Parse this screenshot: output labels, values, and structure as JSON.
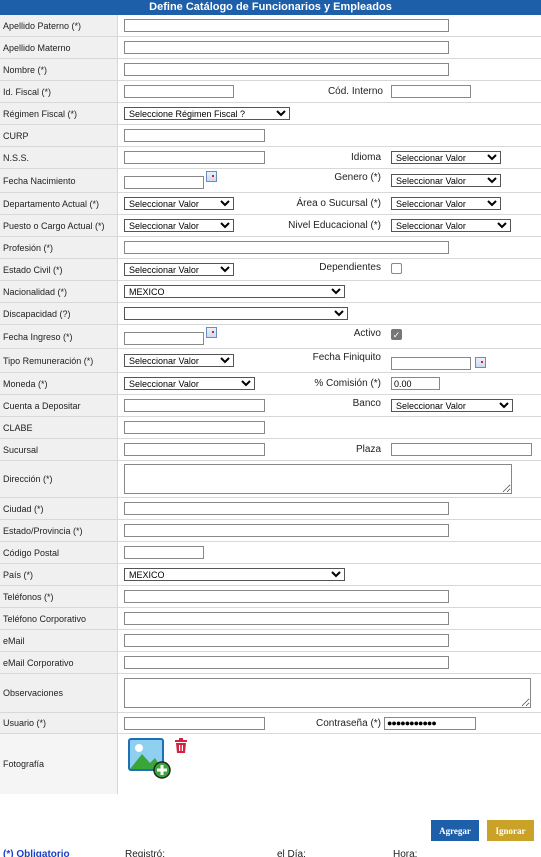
{
  "title": "Define Catálogo de Funcionarios y Empleados",
  "labels": {
    "apellido_paterno": "Apellido Paterno (*)",
    "apellido_materno": "Apellido Materno",
    "nombre": "Nombre (*)",
    "id_fiscal": "Id. Fiscal (*)",
    "cod_interno": "Cód. Interno",
    "regimen_fiscal": "Régimen Fiscal (*)",
    "curp": "CURP",
    "nss": "N.S.S.",
    "idioma": "Idioma",
    "fecha_nacimiento": "Fecha Nacimiento",
    "genero": "Genero (*)",
    "departamento": "Departamento Actual (*)",
    "area": "Área o Sucursal (*)",
    "puesto": "Puesto o Cargo Actual (*)",
    "nivel_educacional": "Nivel Educacional (*)",
    "profesion": "Profesión (*)",
    "estado_civil": "Estado Civil (*)",
    "dependientes": "Dependientes",
    "nacionalidad": "Nacionalidad (*)",
    "discapacidad": "Discapacidad (?)",
    "fecha_ingreso": "Fecha Ingreso (*)",
    "activo": "Activo",
    "tipo_remuneracion": "Tipo Remuneración (*)",
    "fecha_finiquito": "Fecha Finiquito",
    "moneda": "Moneda (*)",
    "comision": "% Comisión (*)",
    "cuenta": "Cuenta a Depositar",
    "banco": "Banco",
    "clabe": "CLABE",
    "sucursal": "Sucursal",
    "plaza": "Plaza",
    "direccion": "Dirección (*)",
    "ciudad": "Ciudad (*)",
    "estado": "Estado/Provincia (*)",
    "codigo_postal": "Código Postal",
    "pais": "País (*)",
    "telefonos": "Teléfonos (*)",
    "telefono_corp": "Teléfono Corporativo",
    "email": "eMail",
    "email_corp": "eMail Corporativo",
    "observaciones": "Observaciones",
    "usuario": "Usuario (*)",
    "contrasena": "Contraseña (*)",
    "fotografia": "Fotografía"
  },
  "selects": {
    "regimen_fiscal": "Seleccione Régimen Fiscal ?",
    "default": "Seleccionar Valor",
    "nacionalidad": "MEXICO",
    "pais": "MEXICO",
    "discapacidad": ""
  },
  "values": {
    "comision": "0.00",
    "password": "●●●●●●●●●●●"
  },
  "buttons": {
    "agregar": "Agregar",
    "ignorar": "Ignorar"
  },
  "footer": {
    "obligatorio": "(*) Obligatorio",
    "registro": "Registró:",
    "el_dia": "el Día:",
    "hora": "Hora:"
  },
  "colors": {
    "header": "#1d5fa8",
    "agregar": "#1d5fa8",
    "ignorar": "#c9a227"
  }
}
